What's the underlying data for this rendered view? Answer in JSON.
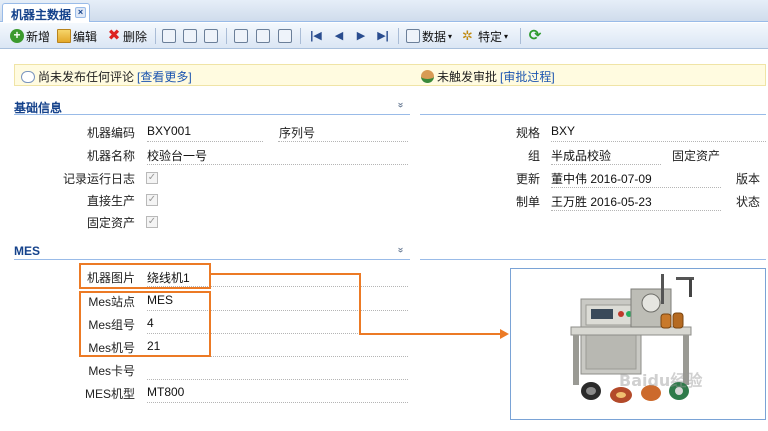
{
  "tab": {
    "title": "机器主数据",
    "close": "×"
  },
  "toolbar": {
    "add": "新增",
    "edit": "编辑",
    "delete": "删除",
    "data": "数据",
    "specific": "特定",
    "caret": "▾"
  },
  "comment_bar": {
    "no_comment": "尚未发布任何评论",
    "view_more": "[查看更多]",
    "no_approval": "未触发审批",
    "approval_process": "[审批过程]"
  },
  "sections": {
    "basic": "基础信息",
    "mes": "MES",
    "chevron": "»"
  },
  "basic_left": {
    "machine_code_label": "机器编码",
    "machine_code": "BXY001",
    "serial_label": "序列号",
    "serial": "",
    "machine_name_label": "机器名称",
    "machine_name": "校验台一号",
    "log_label": "记录运行日志",
    "log_checked": true,
    "direct_prod_label": "直接生产",
    "direct_prod_checked": true,
    "fixed_asset_label": "固定资产",
    "fixed_asset_checked": true
  },
  "basic_right": {
    "spec_label": "规格",
    "spec": "BXY",
    "group_label": "组",
    "group": "半成品校验",
    "fixed_asset_label": "固定资产",
    "update_label": "更新",
    "update": "董中伟 2016-07-09",
    "version_label": "版本",
    "create_label": "制单",
    "create": "王万胜 2016-05-23",
    "status_label": "状态"
  },
  "mes": {
    "image_label": "机器图片",
    "image": "绕线机1",
    "station_label": "Mes站点",
    "station": "MES",
    "group_label": "Mes组号",
    "group": "4",
    "machine_no_label": "Mes机号",
    "machine_no": "21",
    "card_label": "Mes卡号",
    "card": "",
    "model_label": "MES机型",
    "model": "MT800"
  },
  "watermark": "Baidu经验",
  "colors": {
    "accent": "#ec7a25",
    "header": "#15428b",
    "link": "#1c55b0"
  }
}
